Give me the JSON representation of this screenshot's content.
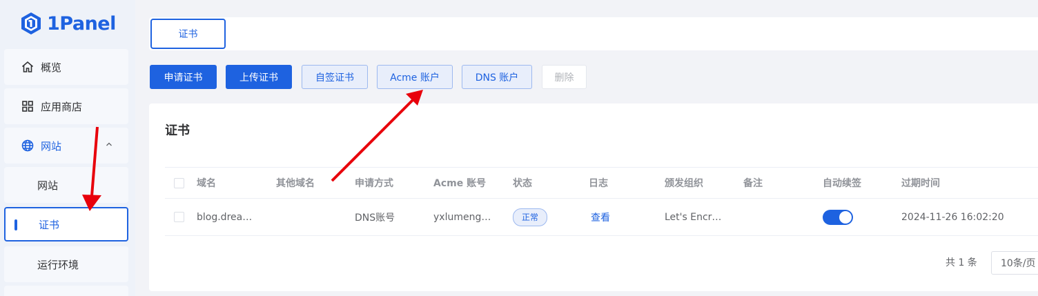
{
  "app": {
    "logo_text": "1Panel"
  },
  "sidebar": {
    "items": [
      {
        "label": "概览"
      },
      {
        "label": "应用商店"
      },
      {
        "label": "网站"
      }
    ],
    "subitems": [
      {
        "label": "网站"
      },
      {
        "label": "证书"
      },
      {
        "label": "运行环境"
      }
    ]
  },
  "header": {
    "tab": "证书"
  },
  "toolbar": {
    "apply": "申请证书",
    "upload": "上传证书",
    "self_signed": "自签证书",
    "acme": "Acme 账户",
    "dns": "DNS 账户",
    "delete": "删除"
  },
  "card": {
    "title": "证书",
    "columns": [
      "域名",
      "其他域名",
      "申请方式",
      "Acme 账号",
      "状态",
      "日志",
      "颁发组织",
      "备注",
      "自动续签",
      "过期时间"
    ],
    "rows": [
      {
        "domain": "blog.drea…",
        "other_domains": "",
        "method": "DNS账号",
        "acme_account": "yxlumeng…",
        "status": "正常",
        "log": "查看",
        "issuer": "Let's Encr…",
        "remark": "",
        "auto_renew": true,
        "expire": "2024-11-26 16:02:20"
      }
    ],
    "pagination": {
      "total": "共 1 条",
      "page_size": "10条/页"
    }
  },
  "colors": {
    "accent": "#1e62e0",
    "annotation_arrow": "#e8000b"
  }
}
